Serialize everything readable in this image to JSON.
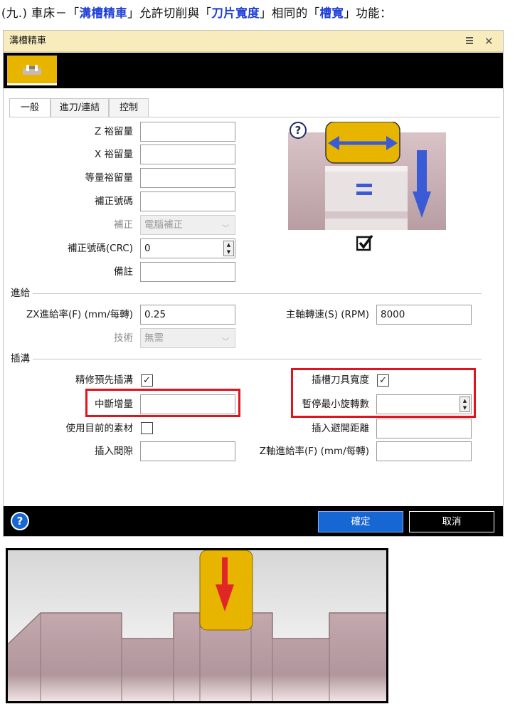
{
  "heading": {
    "prefix": "(九.) 車床－「",
    "op_name": "溝槽精車",
    "middle": "」允許切削與「",
    "param": "刀片寬度",
    "middle2": "」相同的「",
    "feature": "槽寬",
    "suffix": "」功能："
  },
  "dialog": {
    "title": "溝槽精車",
    "pin_icon": "menu-pin-icon",
    "close_glyph": "✕",
    "tabs": [
      "一般",
      "進刀/連結",
      "控制"
    ],
    "general": {
      "z_stock_label": "Z 裕留量",
      "z_stock_value": "",
      "x_stock_label": "X 裕留量",
      "x_stock_value": "",
      "equal_stock_label": "等量裕留量",
      "equal_stock_value": "",
      "comp_num_label": "補正號碼",
      "comp_num_value": "",
      "comp_label": "補正",
      "comp_value": "電腦補正",
      "comp_crc_label": "補正號碼(CRC)",
      "comp_crc_value": "0",
      "notes_label": "備註",
      "notes_value": ""
    },
    "feed_group": {
      "title": "進給",
      "zx_feed_label": "ZX進給率(F) (mm/每轉)",
      "zx_feed_value": "0.25",
      "spindle_label": "主軸轉速(S) (RPM)",
      "spindle_value": "8000",
      "tech_label": "技術",
      "tech_value": "無需"
    },
    "plunge_group": {
      "title": "插溝",
      "finish_first_label": "精修預先插溝",
      "finish_first_checked": "✓",
      "interrupt_label": "中斷增量",
      "interrupt_value": "",
      "use_stock_label": "使用目前的素材",
      "use_stock_checked": "",
      "plunge_clear_label": "插入間隙",
      "plunge_clear_value": "",
      "tool_width_label": "插槽刀具寬度",
      "tool_width_checked": "✓",
      "dwell_label": "暫停最小旋轉數",
      "dwell_value": "",
      "avoid_label": "插入避開距離",
      "avoid_value": "",
      "z_feed_label": "Z軸進給率(F) (mm/每轉)",
      "z_feed_value": ""
    },
    "preview_check": "☑",
    "help_glyph": "?",
    "ok_label": "確定",
    "cancel_label": "取消"
  },
  "colors": {
    "titlebar": "#f8ecbd",
    "tool_yellow": "#e7b400",
    "arrow_blue": "#3b5bd6",
    "arrow_red": "#e02626",
    "highlight_red": "#e0141c",
    "ok_blue": "#1666d4",
    "stock_pink": "#cdb3b7"
  }
}
